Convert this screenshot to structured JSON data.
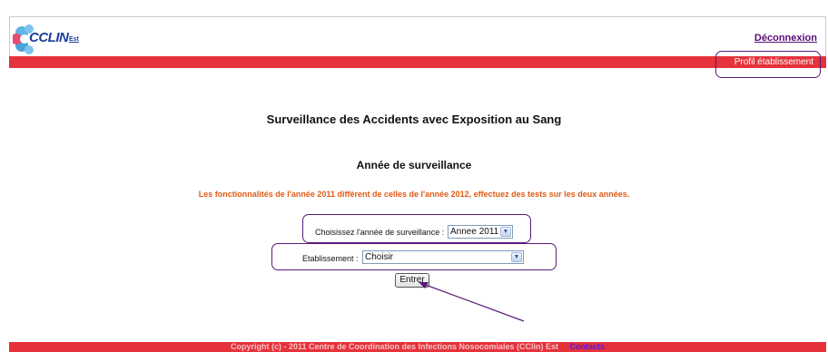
{
  "header": {
    "logo_text": "CCLIN",
    "logo_sub": "Est",
    "logout_label": "Déconnexion",
    "profile_label": "Profil établissement"
  },
  "main": {
    "title": "Surveillance des Accidents avec Exposition au Sang",
    "subtitle": "Année de surveillance",
    "notice": "Les fonctionnalités de l'année 2011 diffèrent de celles de l'année 2012, effectuez des tests sur les deux années.",
    "year_label": "Choisissez l'année de surveillance :",
    "year_value": "Annee 2011",
    "etab_label": "Etablissement :",
    "etab_value": "Choisir",
    "enter_label": "Entrer"
  },
  "footer": {
    "copyright": "Copyright (c) - 2011 Centre de Coordination des Infections Nosocomiales (CClin) Est",
    "contacts_label": "Contacts"
  },
  "colors": {
    "brand_red": "#e5323b",
    "annotation_purple": "#5a1a7a",
    "notice_orange": "#e05a12"
  }
}
